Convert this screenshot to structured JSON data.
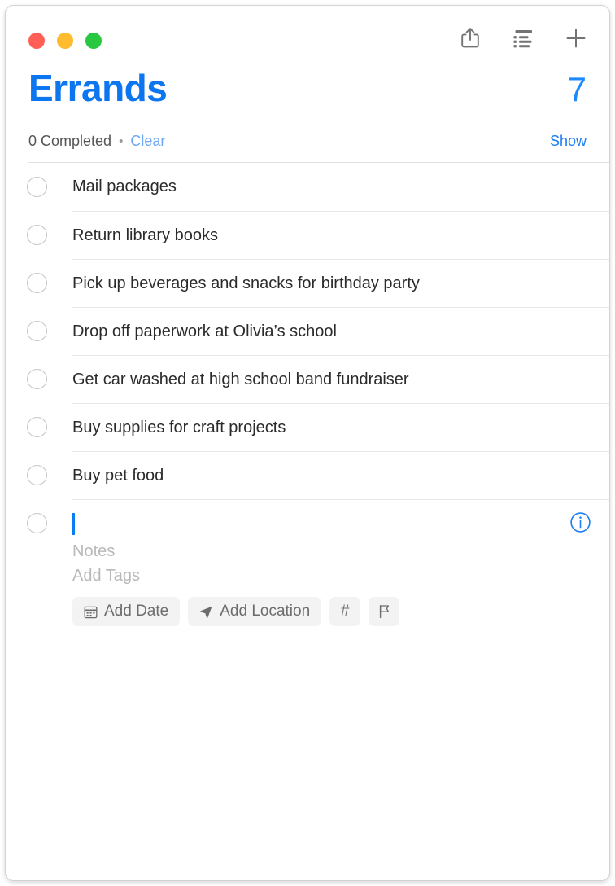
{
  "window": {
    "traffic_lights": [
      {
        "name": "close",
        "color": "#ff5f57"
      },
      {
        "name": "minimize",
        "color": "#febc2e"
      },
      {
        "name": "zoom",
        "color": "#28c840"
      }
    ]
  },
  "toolbar": {
    "actions": [
      {
        "icon": "share-icon",
        "label": "Share"
      },
      {
        "icon": "list-options-icon",
        "label": "List Options"
      },
      {
        "icon": "plus-icon",
        "label": "Add Reminder"
      }
    ]
  },
  "header": {
    "title": "Errands",
    "count": "7",
    "completed_text": "0 Completed",
    "separator": "•",
    "clear_label": "Clear",
    "show_label": "Show",
    "title_color": "#0b76ef",
    "count_color": "#1b8aff",
    "clear_color": "#6ea9f3",
    "show_color": "#1b7ef4"
  },
  "tasks": [
    {
      "title": "Mail packages",
      "completed": false
    },
    {
      "title": "Return library books",
      "completed": false
    },
    {
      "title": "Pick up beverages and snacks for birthday party",
      "completed": false
    },
    {
      "title": "Drop off paperwork at Olivia’s school",
      "completed": false
    },
    {
      "title": "Get car washed at high school band fundraiser",
      "completed": false
    },
    {
      "title": "Buy supplies for craft projects",
      "completed": false
    },
    {
      "title": "Buy pet food",
      "completed": false
    }
  ],
  "new_task": {
    "title_value": "",
    "notes_placeholder": "Notes",
    "tags_placeholder": "Add Tags",
    "caret_color": "#0a7cf7",
    "info_icon": "info-circle-icon",
    "chips": [
      {
        "icon": "calendar-icon",
        "label": "Add Date"
      },
      {
        "icon": "location-arrow-icon",
        "label": "Add Location"
      },
      {
        "icon": "hashtag-icon",
        "label": "#"
      },
      {
        "icon": "flag-icon",
        "label": ""
      }
    ]
  }
}
